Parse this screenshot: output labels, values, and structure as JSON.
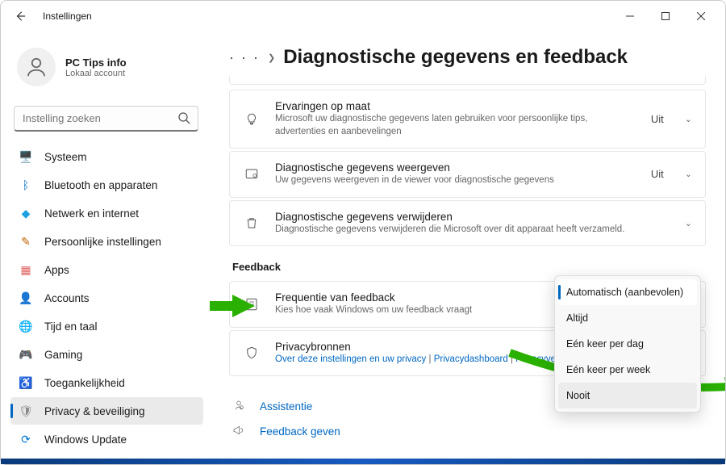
{
  "window": {
    "title": "Instellingen"
  },
  "user": {
    "name": "PC Tips info",
    "sub": "Lokaal account"
  },
  "search": {
    "placeholder": "Instelling zoeken"
  },
  "nav": [
    {
      "id": "system",
      "label": "Systeem",
      "icon": "🖥️",
      "color": "#0067c0"
    },
    {
      "id": "bluetooth",
      "label": "Bluetooth en apparaten",
      "icon": "ᛒ",
      "color": "#0067c0"
    },
    {
      "id": "network",
      "label": "Netwerk en internet",
      "icon": "◆",
      "color": "#1ba0e0"
    },
    {
      "id": "personal",
      "label": "Persoonlijke instellingen",
      "icon": "✎",
      "color": "#c06000"
    },
    {
      "id": "apps",
      "label": "Apps",
      "icon": "▦",
      "color": "#e06060"
    },
    {
      "id": "accounts",
      "label": "Accounts",
      "icon": "👤",
      "color": "#c09000"
    },
    {
      "id": "time",
      "label": "Tijd en taal",
      "icon": "🌐",
      "color": "#2090c0"
    },
    {
      "id": "gaming",
      "label": "Gaming",
      "icon": "🎮",
      "color": "#666"
    },
    {
      "id": "access",
      "label": "Toegankelijkheid",
      "icon": "♿",
      "color": "#2060c0"
    },
    {
      "id": "privacy",
      "label": "Privacy & beveiliging",
      "icon": "🛡",
      "color": "#888",
      "active": true
    },
    {
      "id": "update",
      "label": "Windows Update",
      "icon": "⟳",
      "color": "#0078d4"
    }
  ],
  "page": {
    "title": "Diagnostische gegevens en feedback",
    "crumb_more": "· · ·"
  },
  "cards": {
    "tailored": {
      "title": "Ervaringen op maat",
      "desc": "Microsoft uw diagnostische gegevens laten gebruiken voor persoonlijke tips, advertenties en aanbevelingen",
      "value": "Uit"
    },
    "view": {
      "title": "Diagnostische gegevens weergeven",
      "desc": "Uw gegevens weergeven in de viewer voor diagnostische gegevens",
      "value": "Uit"
    },
    "delete": {
      "title": "Diagnostische gegevens verwijderen",
      "desc": "Diagnostische gegevens verwijderen die Microsoft over dit apparaat heeft verzameld."
    },
    "feedback_section": "Feedback",
    "freq": {
      "title": "Frequentie van feedback",
      "desc": "Kies hoe vaak Windows om uw feedback vraagt"
    },
    "privacy": {
      "title": "Privacybronnen",
      "link1": "Over deze instellingen en uw privacy",
      "link2": "Privacydashboard",
      "link3": "Privacyve"
    }
  },
  "footer": {
    "help": "Assistentie",
    "feedback": "Feedback geven"
  },
  "dropdown": {
    "options": [
      "Automatisch (aanbevolen)",
      "Altijd",
      "Eén keer per dag",
      "Eén keer per week",
      "Nooit"
    ]
  }
}
